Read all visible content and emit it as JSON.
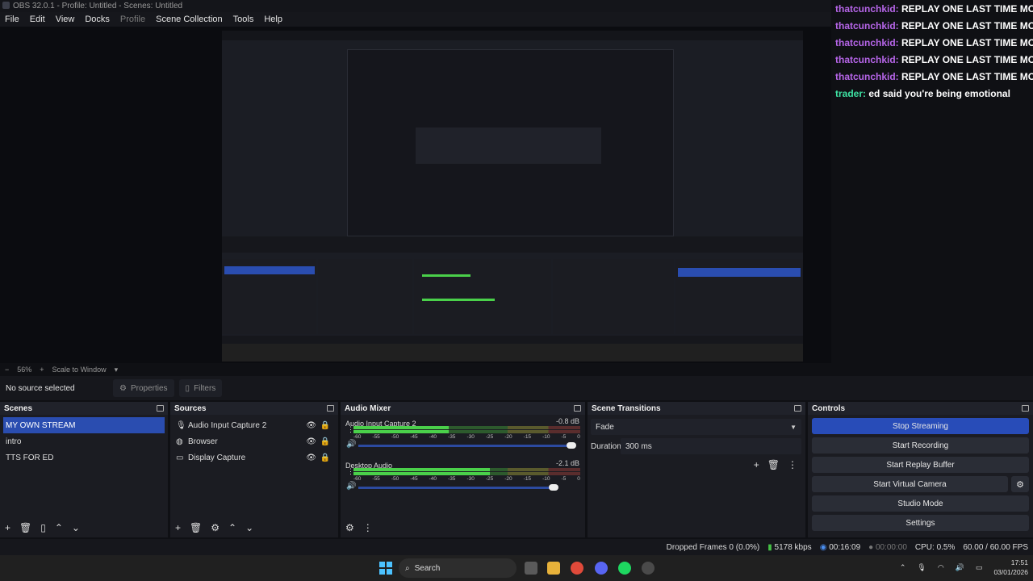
{
  "window": {
    "title": "OBS 32.0.1 - Profile: Untitled - Scenes: Untitled"
  },
  "menu": [
    "File",
    "Edit",
    "View",
    "Docks",
    "Profile",
    "Scene Collection",
    "Tools",
    "Help"
  ],
  "chat": [
    {
      "user": "thatcunchkid:",
      "message": "REPLAY ONE LAST TIME MORE W"
    },
    {
      "user": "thatcunchkid:",
      "message": "REPLAY ONE LAST TIME MORE W"
    },
    {
      "user": "thatcunchkid:",
      "message": "REPLAY ONE LAST TIME MORE W"
    },
    {
      "user": "thatcunchkid:",
      "message": "REPLAY ONE LAST TIME MORE W"
    },
    {
      "user": "thatcunchkid:",
      "message": "REPLAY ONE LAST TIME MORE W"
    },
    {
      "user": "trader:",
      "message": "ed said you're being emotional"
    }
  ],
  "zoom": {
    "minus": "−",
    "value": "56%",
    "plus": "+",
    "mode": "Scale to Window"
  },
  "source_bar": {
    "no_selection": "No source selected",
    "properties": "Properties",
    "filters": "Filters"
  },
  "scenes": {
    "title": "Scenes",
    "items": [
      "MY OWN STREAM",
      "intro",
      "TTS FOR ED"
    ],
    "selected": 0
  },
  "sources": {
    "title": "Sources",
    "items": [
      {
        "name": "Audio Input Capture 2",
        "icon": "microphone-icon"
      },
      {
        "name": "Browser",
        "icon": "globe-icon"
      },
      {
        "name": "Display Capture",
        "icon": "monitor-icon"
      }
    ]
  },
  "mixer": {
    "title": "Audio Mixer",
    "channels": [
      {
        "name": "Audio Input Capture 2",
        "db": "-0.8 dB",
        "level": 0.42,
        "volume": 1.0
      },
      {
        "name": "Desktop Audio",
        "db": "-2.1 dB",
        "level": 0.6,
        "volume": 0.95
      }
    ],
    "scale": [
      "-60",
      "-55",
      "-50",
      "-45",
      "-40",
      "-35",
      "-30",
      "-25",
      "-20",
      "-15",
      "-10",
      "-5",
      "0"
    ]
  },
  "transitions": {
    "title": "Scene Transitions",
    "selected": "Fade",
    "duration_label": "Duration",
    "duration_value": "300 ms"
  },
  "controls": {
    "title": "Controls",
    "stop_streaming": "Stop Streaming",
    "start_recording": "Start Recording",
    "start_replay": "Start Replay Buffer",
    "start_virtual_camera": "Start Virtual Camera",
    "studio_mode": "Studio Mode",
    "settings": "Settings"
  },
  "status": {
    "dropped_frames": "Dropped Frames 0 (0.0%)",
    "bitrate": "5178 kbps",
    "stream_time": "00:16:09",
    "record_time": "00:00:00",
    "cpu": "CPU: 0.5%",
    "fps": "60.00 / 60.00 FPS"
  },
  "taskbar": {
    "search": "Search",
    "time": "17:51",
    "date": "03/01/2026"
  },
  "colors": {
    "accent": "#2a4db0",
    "chat_user": "#b665e8",
    "chat_user_alt": "#3ee2a3"
  }
}
